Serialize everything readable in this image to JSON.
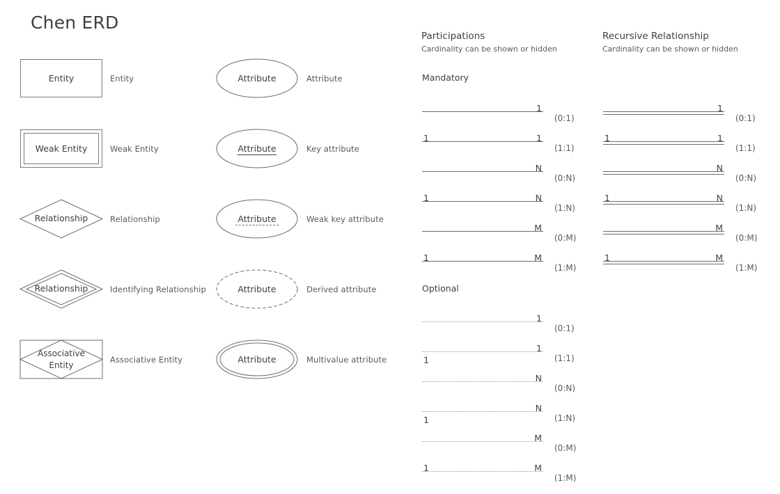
{
  "title": "Chen ERD",
  "legend": {
    "entities": [
      {
        "shape": "rectangle",
        "shape_text": "Entity",
        "label": "Entity"
      },
      {
        "shape": "double-rectangle",
        "shape_text": "Weak Entity",
        "label": "Weak Entity"
      },
      {
        "shape": "diamond",
        "shape_text": "Relationship",
        "label": "Relationship"
      },
      {
        "shape": "double-diamond",
        "shape_text": "Relationship",
        "label": "Identifying Relationship"
      },
      {
        "shape": "rectangle-diamond",
        "shape_text": "Associative Entity",
        "label": "Associative Entity"
      }
    ],
    "attributes": [
      {
        "shape": "ellipse",
        "shape_text": "Attribute",
        "underline": "none",
        "label": "Attribute"
      },
      {
        "shape": "ellipse",
        "shape_text": "Attribute",
        "underline": "solid",
        "label": "Key attribute"
      },
      {
        "shape": "ellipse",
        "shape_text": "Attribute",
        "underline": "dashed",
        "label": "Weak key attribute"
      },
      {
        "shape": "dashed-ellipse",
        "shape_text": "Attribute",
        "underline": "none",
        "label": "Derived attribute"
      },
      {
        "shape": "double-ellipse",
        "shape_text": "Attribute",
        "underline": "none",
        "label": "Multivalue attribute"
      }
    ]
  },
  "participations": {
    "title": "Participations",
    "subtitle": "Cardinality can be shown or hidden",
    "groups": [
      {
        "name": "Mandatory",
        "line_style": "solid",
        "rows": [
          {
            "left": "",
            "right": "1",
            "left_pos": "above",
            "right_pos": "above",
            "pair": "(0:1)"
          },
          {
            "left": "1",
            "right": "1",
            "left_pos": "above",
            "right_pos": "above",
            "pair": "(1:1)"
          },
          {
            "left": "",
            "right": "N",
            "left_pos": "above",
            "right_pos": "above",
            "pair": "(0:N)"
          },
          {
            "left": "1",
            "right": "N",
            "left_pos": "above",
            "right_pos": "above",
            "pair": "(1:N)"
          },
          {
            "left": "",
            "right": "M",
            "left_pos": "above",
            "right_pos": "above",
            "pair": "(0:M)"
          },
          {
            "left": "1",
            "right": "M",
            "left_pos": "above",
            "right_pos": "above",
            "pair": "(1:M)"
          }
        ]
      },
      {
        "name": "Optional",
        "line_style": "dotted",
        "rows": [
          {
            "left": "",
            "right": "1",
            "left_pos": "above",
            "right_pos": "above",
            "pair": "(0:1)"
          },
          {
            "left": "1",
            "right": "1",
            "left_pos": "below",
            "right_pos": "above",
            "pair": "(1:1)"
          },
          {
            "left": "",
            "right": "N",
            "left_pos": "above",
            "right_pos": "above",
            "pair": "(0:N)"
          },
          {
            "left": "1",
            "right": "N",
            "left_pos": "below",
            "right_pos": "above",
            "pair": "(1:N)"
          },
          {
            "left": "",
            "right": "M",
            "left_pos": "above",
            "right_pos": "above",
            "pair": "(0:M)"
          },
          {
            "left": "1",
            "right": "M",
            "left_pos": "above",
            "right_pos": "above",
            "pair": "(1:M)"
          }
        ]
      }
    ]
  },
  "recursive": {
    "title": "Recursive Relationship",
    "subtitle": "Cardinality can be shown or hidden",
    "line_style": "double",
    "rows": [
      {
        "left": "",
        "right": "1",
        "left_pos": "above",
        "right_pos": "above",
        "pair": "(0:1)"
      },
      {
        "left": "1",
        "right": "1",
        "left_pos": "above",
        "right_pos": "above",
        "pair": "(1:1)"
      },
      {
        "left": "",
        "right": "N",
        "left_pos": "above",
        "right_pos": "above",
        "pair": "(0:N)"
      },
      {
        "left": "1",
        "right": "N",
        "left_pos": "above",
        "right_pos": "above",
        "pair": "(1:N)"
      },
      {
        "left": "",
        "right": "M",
        "left_pos": "above",
        "right_pos": "above",
        "pair": "(0:M)"
      },
      {
        "left": "1",
        "right": "M",
        "left_pos": "above",
        "right_pos": "above",
        "pair": "(1:M)"
      }
    ]
  },
  "colors": {
    "stroke": "#6b6b6b",
    "text": "#3f3f3f",
    "label": "#58595b",
    "dotted": "#9a9a9a"
  }
}
